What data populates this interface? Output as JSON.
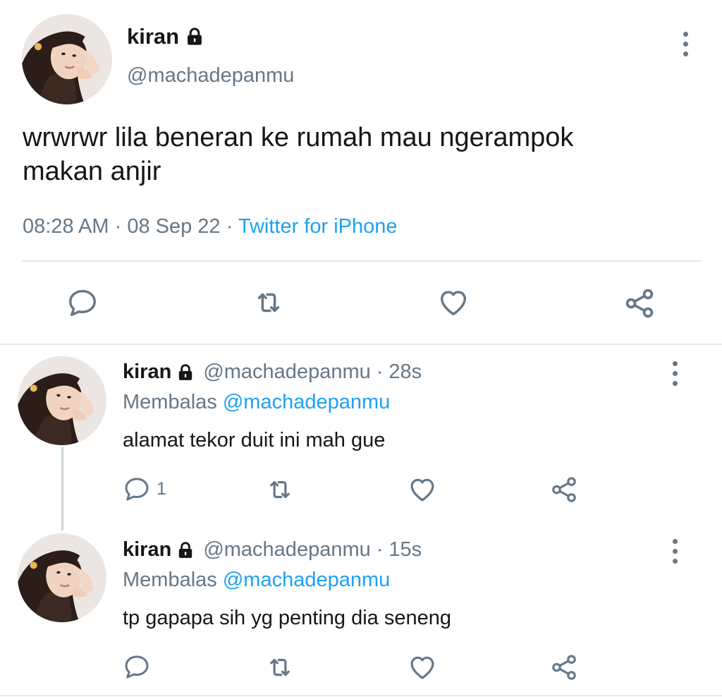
{
  "main_tweet": {
    "display_name": "kiran",
    "handle": "@machadepanmu",
    "text_line1": "wrwrwr lila beneran ke rumah mau ngerampok",
    "text_line2": "makan anjir",
    "time": "08:28 AM",
    "date": "08 Sep 22",
    "separator": "·",
    "source": "Twitter for iPhone"
  },
  "replies": [
    {
      "display_name": "kiran",
      "handle": "@machadepanmu",
      "separator": "·",
      "age": "28s",
      "replying_prefix": "Membalas",
      "replying_to": "@machadepanmu",
      "text": "alamat tekor duit ini mah gue",
      "reply_count": "1"
    },
    {
      "display_name": "kiran",
      "handle": "@machadepanmu",
      "separator": "·",
      "age": "15s",
      "replying_prefix": "Membalas",
      "replying_to": "@machadepanmu",
      "text": "tp gapapa sih yg penting dia seneng",
      "reply_count": ""
    }
  ],
  "icons": {
    "lock": "lock-icon",
    "more": "more-icon",
    "reply": "reply-icon",
    "retweet": "retweet-icon",
    "like": "like-icon",
    "share": "share-icon"
  },
  "colors": {
    "text": "#14171a",
    "muted": "#657786",
    "link": "#1da1f2",
    "divider": "#e1e8ed",
    "thread_line": "#ccd6dd"
  }
}
